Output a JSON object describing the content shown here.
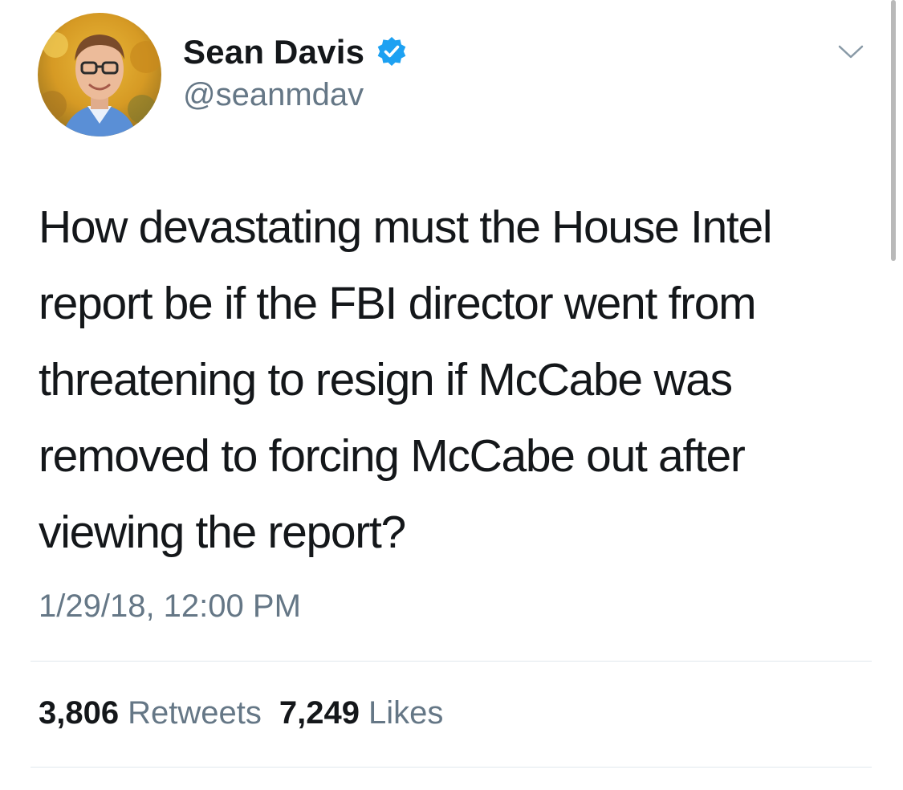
{
  "user": {
    "display_name": "Sean Davis",
    "handle": "@seanmdav",
    "verified": true
  },
  "tweet": {
    "text": "How devastating must the House Intel\nreport be if the FBI director went from\nthreatening to resign if McCabe was\nremoved to forcing McCabe out after\nviewing the report?",
    "timestamp": "1/29/18, 12:00 PM"
  },
  "stats": {
    "retweets_count": "3,806",
    "retweets_label": "Retweets",
    "likes_count": "7,249",
    "likes_label": "Likes"
  },
  "icons": {
    "verified": "verified-badge-icon",
    "menu": "chevron-down-icon"
  },
  "colors": {
    "verified_blue": "#1da1f2",
    "secondary_text": "#657786",
    "primary_text": "#14171a",
    "divider": "#e1e8ed"
  }
}
